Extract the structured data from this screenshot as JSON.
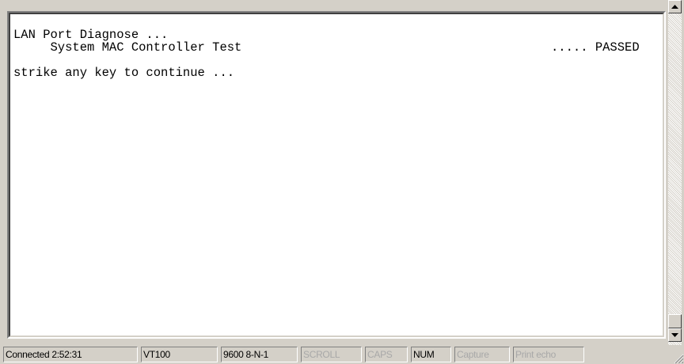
{
  "terminal": {
    "lines": [
      "LAN Port Diagnose ...",
      "     System MAC Controller Test                                          ..... PASSED",
      "",
      "strike any key to continue ..."
    ]
  },
  "statusbar": {
    "connected": "Connected 2:52:31",
    "emulation": "VT100",
    "port_settings": "9600 8-N-1",
    "scroll": "SCROLL",
    "caps": "CAPS",
    "num": "NUM",
    "capture": "Capture",
    "print_echo": "Print echo"
  },
  "icons": {
    "scroll_up": "triangle-up-icon",
    "scroll_down": "triangle-down-icon",
    "size_grip": "resize-grip-icon"
  },
  "colors": {
    "chrome": "#d4d0c8",
    "terminal_bg": "#ffffff",
    "disabled_text": "#a8a8a8"
  }
}
